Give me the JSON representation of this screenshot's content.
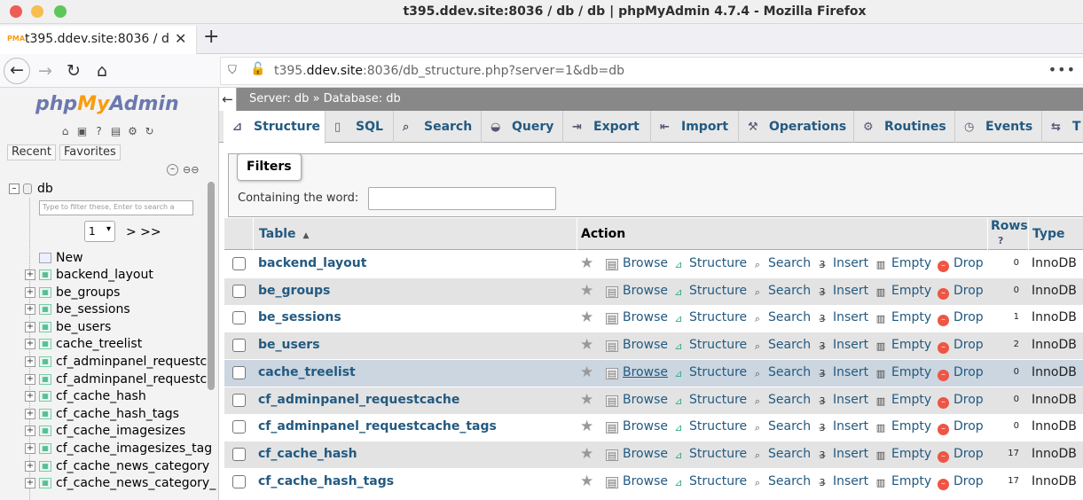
{
  "window": {
    "title": "t395.ddev.site:8036 / db / db | phpMyAdmin 4.7.4 - Mozilla Firefox"
  },
  "browser": {
    "tab_title": "t395.ddev.site:8036 / db",
    "url_domain_pre": "t395.",
    "url_domain": "ddev.site",
    "url_rest": ":8036/db_structure.php?server=1&db=db"
  },
  "left": {
    "logo_php": "php",
    "logo_my": "My",
    "logo_admin": "Admin",
    "recent": "Recent",
    "favorites": "Favorites",
    "db_name": "db",
    "filter_placeholder": "Type to filter these, Enter to search a",
    "page": "1",
    "page_next": "> >>",
    "new_label": "New",
    "items": [
      "backend_layout",
      "be_groups",
      "be_sessions",
      "be_users",
      "cache_treelist",
      "cf_adminpanel_requestca",
      "cf_adminpanel_requestca",
      "cf_cache_hash",
      "cf_cache_hash_tags",
      "cf_cache_imagesizes",
      "cf_cache_imagesizes_tag",
      "cf_cache_news_category",
      "cf_cache_news_category_"
    ]
  },
  "main": {
    "breadcrumb_server": "Server: db",
    "breadcrumb_sep": "»",
    "breadcrumb_db": "Database: db",
    "tabs": [
      "Structure",
      "SQL",
      "Search",
      "Query",
      "Export",
      "Import",
      "Operations",
      "Routines",
      "Events",
      "T"
    ],
    "filters_legend": "Filters",
    "containing_label": "Containing the word:",
    "col_table": "Table",
    "col_action": "Action",
    "col_rows": "Rows",
    "col_type": "Type",
    "actions": {
      "browse": "Browse",
      "structure": "Structure",
      "search": "Search",
      "insert": "Insert",
      "empty": "Empty",
      "drop": "Drop"
    },
    "rows": [
      {
        "name": "backend_layout",
        "rows": "0",
        "type": "InnoDB"
      },
      {
        "name": "be_groups",
        "rows": "0",
        "type": "InnoDB"
      },
      {
        "name": "be_sessions",
        "rows": "1",
        "type": "InnoDB"
      },
      {
        "name": "be_users",
        "rows": "2",
        "type": "InnoDB"
      },
      {
        "name": "cache_treelist",
        "rows": "0",
        "type": "InnoDB"
      },
      {
        "name": "cf_adminpanel_requestcache",
        "rows": "0",
        "type": "InnoDB"
      },
      {
        "name": "cf_adminpanel_requestcache_tags",
        "rows": "0",
        "type": "InnoDB"
      },
      {
        "name": "cf_cache_hash",
        "rows": "17",
        "type": "InnoDB"
      },
      {
        "name": "cf_cache_hash_tags",
        "rows": "17",
        "type": "InnoDB"
      }
    ]
  }
}
